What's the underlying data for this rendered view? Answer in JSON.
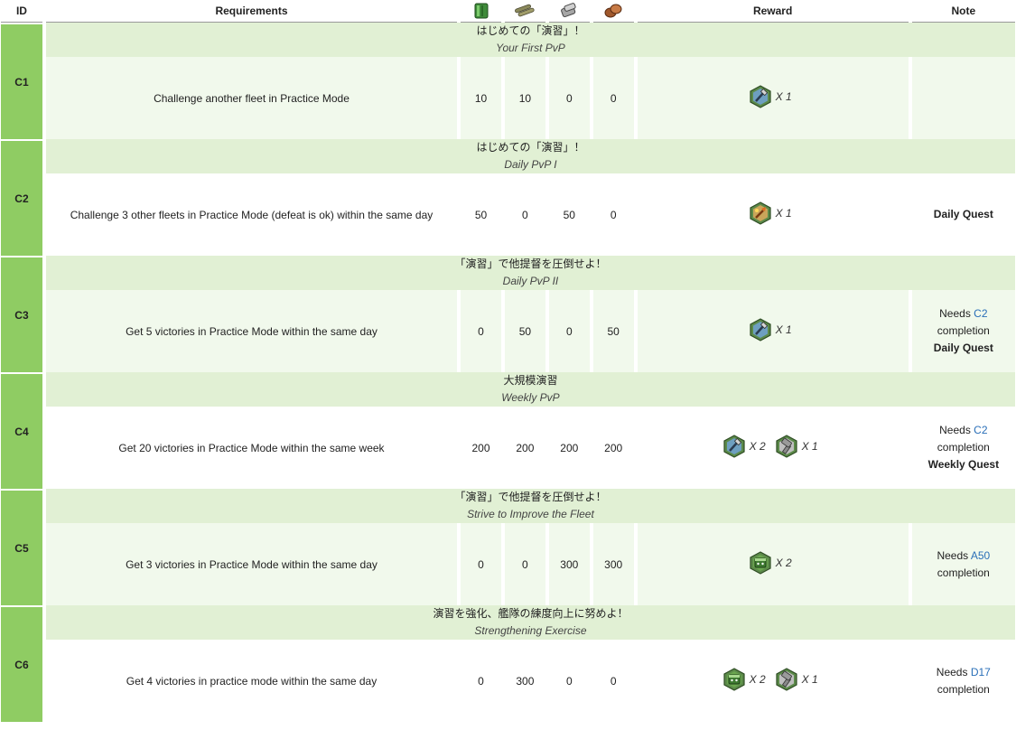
{
  "headers": {
    "id": "ID",
    "requirements": "Requirements",
    "reward": "Reward",
    "note": "Note",
    "resource_icons": [
      "fuel-icon",
      "ammo-icon",
      "steel-icon",
      "bauxite-icon"
    ]
  },
  "colors": {
    "id_column": "#8fcc63",
    "title_row": "#e1f0d4",
    "shaded_row": "#f1f9ec",
    "link": "#2a6fb8"
  },
  "quests": [
    {
      "id": "C1",
      "jp": "はじめての「演習」！",
      "en": "Your First PvP",
      "req": "Challenge another fleet in Practice Mode",
      "res": [
        "10",
        "10",
        "0",
        "0"
      ],
      "rewards": [
        {
          "icon": "construction-material-icon",
          "mult": "X 1"
        }
      ],
      "note": {
        "pre": "",
        "link": "",
        "post": "",
        "bold": ""
      }
    },
    {
      "id": "C2",
      "jp": "はじめての「演習」！",
      "en": "Daily PvP I",
      "req": "Challenge 3 other fleets in Practice Mode (defeat is ok) within the same day",
      "res": [
        "50",
        "0",
        "50",
        "0"
      ],
      "rewards": [
        {
          "icon": "instant-construction-icon",
          "mult": "X 1"
        }
      ],
      "note": {
        "pre": "",
        "link": "",
        "post": "",
        "bold": "Daily Quest"
      }
    },
    {
      "id": "C3",
      "jp": "「演習」で他提督を圧倒せよ！",
      "en": "Daily PvP II",
      "req": "Get 5 victories in Practice Mode within the same day",
      "res": [
        "0",
        "50",
        "0",
        "50"
      ],
      "rewards": [
        {
          "icon": "construction-material-icon",
          "mult": "X 1"
        }
      ],
      "note": {
        "pre": "Needs ",
        "link": "C2",
        "post": " completion",
        "bold": "Daily Quest"
      }
    },
    {
      "id": "C4",
      "jp": "大規模演習",
      "en": "Weekly PvP",
      "req": "Get 20 victories in Practice Mode within the same week",
      "res": [
        "200",
        "200",
        "200",
        "200"
      ],
      "rewards": [
        {
          "icon": "construction-material-icon",
          "mult": "X 2"
        },
        {
          "icon": "improvement-material-icon",
          "mult": "X 1"
        }
      ],
      "note": {
        "pre": "Needs ",
        "link": "C2",
        "post": " completion",
        "bold": "Weekly Quest"
      }
    },
    {
      "id": "C5",
      "jp": "「演習」で他提督を圧倒せよ！",
      "en": "Strive to Improve the Fleet",
      "req": "Get 3 victories in Practice Mode within the same day",
      "res": [
        "0",
        "0",
        "300",
        "300"
      ],
      "rewards": [
        {
          "icon": "furniture-box-icon",
          "mult": "X 2"
        }
      ],
      "note": {
        "pre": "Needs ",
        "link": "A50",
        "post": " completion",
        "bold": ""
      }
    },
    {
      "id": "C6",
      "jp": "演習を強化、艦隊の練度向上に努めよ！",
      "en": "Strengthening Exercise",
      "req": "Get 4 victories in practice mode within the same day",
      "res": [
        "0",
        "300",
        "0",
        "0"
      ],
      "rewards": [
        {
          "icon": "furniture-box-icon",
          "mult": "X 2"
        },
        {
          "icon": "improvement-material-icon",
          "mult": "X 1"
        }
      ],
      "note": {
        "pre": "Needs ",
        "link": "D17",
        "post": " completion",
        "bold": ""
      }
    }
  ]
}
